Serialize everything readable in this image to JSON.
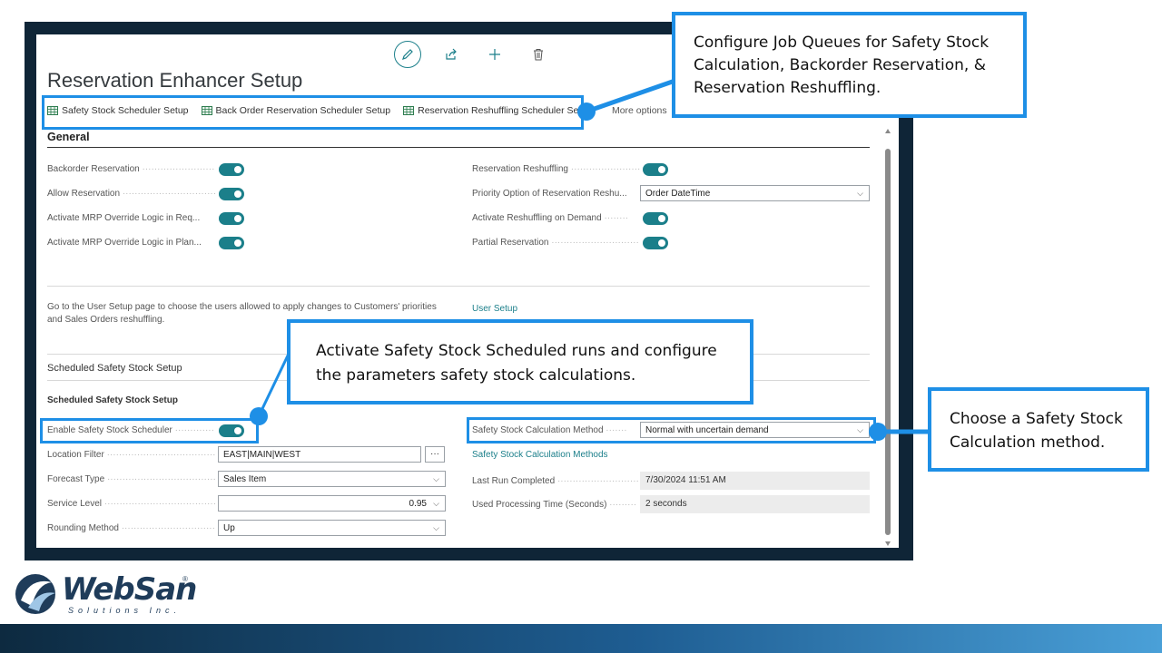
{
  "page_title": "Reservation Enhancer Setup",
  "toolbar_icons": [
    "edit-icon",
    "share-icon",
    "plus-icon",
    "trash-icon"
  ],
  "action_bar": {
    "items": [
      "Safety Stock Scheduler Setup",
      "Back Order Reservation Scheduler Setup",
      "Reservation Reshuffling Scheduler Setup"
    ],
    "more_options": "More options"
  },
  "general": {
    "heading": "General",
    "left_toggles": [
      "Backorder Reservation",
      "Allow Reservation",
      "Activate MRP Override Logic in Req...",
      "Activate MRP Override Logic in Plan..."
    ],
    "right": {
      "reservation_reshuffling": "Reservation Reshuffling",
      "priority_option_label": "Priority Option of Reservation Reshu...",
      "priority_option_value": "Order DateTime",
      "activate_reshuffling": "Activate Reshuffling on Demand",
      "partial_reservation": "Partial Reservation"
    },
    "user_setup_text_line1": "Go to the User Setup page to choose the users allowed to apply changes to Customers' priorities",
    "user_setup_text_line2": "and Sales Orders reshuffling.",
    "user_setup_link": "User Setup"
  },
  "scheduled": {
    "section_title": "Scheduled Safety Stock Setup",
    "subsection_title": "Scheduled Safety Stock Setup",
    "enable_label": "Enable Safety Stock Scheduler",
    "location_filter_label": "Location Filter",
    "location_filter_value": "EAST|MAIN|WEST",
    "lookup_glyph": "···",
    "forecast_type_label": "Forecast Type",
    "forecast_type_value": "Sales Item",
    "service_level_label": "Service Level",
    "service_level_value": "0.95",
    "rounding_method_label": "Rounding Method",
    "rounding_method_value": "Up",
    "calc_method_label": "Safety Stock Calculation Method",
    "calc_method_value": "Normal with uncertain demand",
    "calc_methods_link": "Safety Stock Calculation Methods",
    "last_run_label": "Last Run Completed",
    "last_run_value": "7/30/2024 11:51 AM",
    "processing_time_label": "Used Processing Time (Seconds)",
    "processing_time_value": "2 seconds"
  },
  "callouts": {
    "job_queues": "Configure Job Queues for Safety Stock Calculation, Backorder Reservation, & Reservation Reshuffling.",
    "activate_scheduled": "Activate Safety Stock Scheduled runs and configure the parameters safety stock calculations.",
    "calc_method": "Choose a Safety Stock Calculation method."
  },
  "logo": {
    "name": "WebSan",
    "tagline": "Solutions Inc.",
    "mark": "®"
  },
  "colors": {
    "accent": "#1b7f8a",
    "callout": "#1e8fe6",
    "frame": "#0f2537"
  }
}
